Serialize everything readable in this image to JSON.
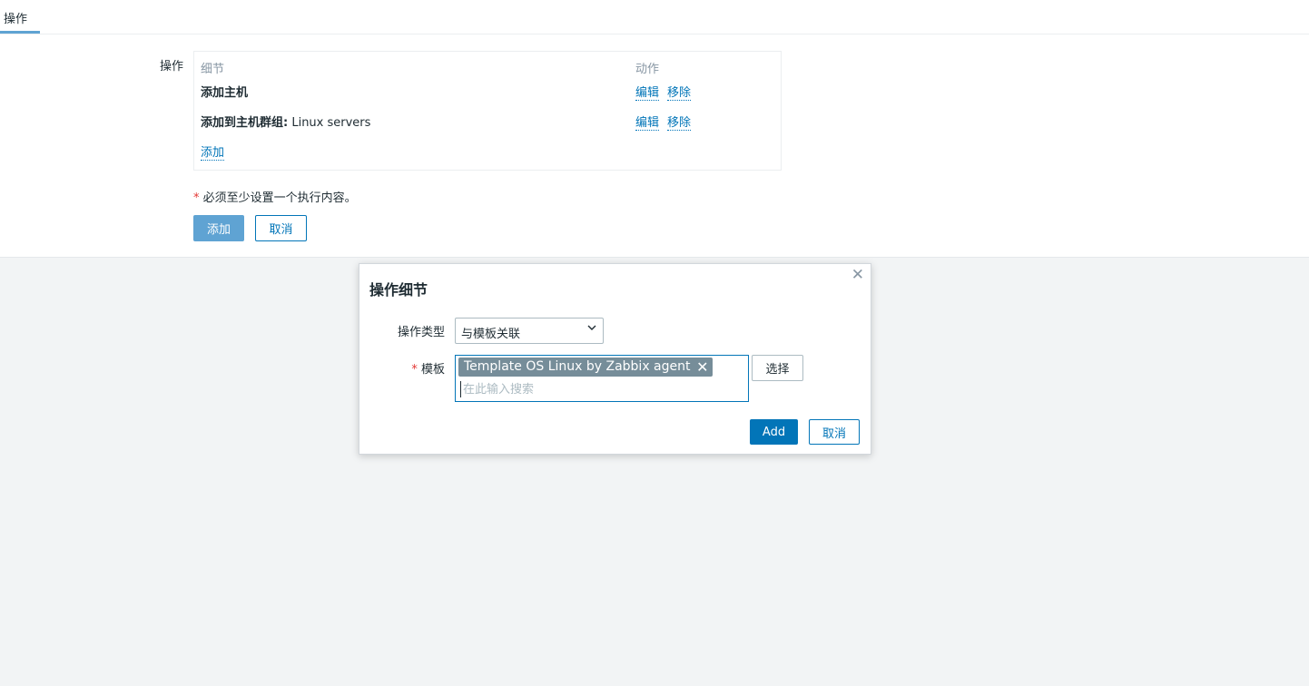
{
  "tabs": [
    {
      "label": "操作",
      "active": true
    }
  ],
  "operations": {
    "field_label": "操作",
    "headers": {
      "details": "细节",
      "actions": "动作"
    },
    "rows": [
      {
        "detail_bold": "添加主机",
        "detail_rest": "",
        "edit": "编辑",
        "remove": "移除"
      },
      {
        "detail_bold": "添加到主机群组:",
        "detail_rest": " Linux servers",
        "edit": "编辑",
        "remove": "移除"
      }
    ],
    "add_link": "添加"
  },
  "requirement_note": {
    "asterisk": "*",
    "text": "必须至少设置一个执行内容。"
  },
  "form_buttons": {
    "add": "添加",
    "cancel": "取消"
  },
  "dialog": {
    "title": "操作细节",
    "close_icon": "close-icon",
    "operation_type_label": "操作类型",
    "operation_type_value": "与模板关联",
    "template_label_required": "*",
    "template_label": "模板",
    "selected_templates": [
      "Template OS Linux by Zabbix agent"
    ],
    "search_placeholder": "在此输入搜索",
    "select_button": "选择",
    "add_button": "Add",
    "cancel_button": "取消"
  },
  "colors": {
    "accent": "#0275b8",
    "accent_faded": "#5fa3d3",
    "required": "#e33734",
    "chip_bg": "#768d99",
    "page_bg": "#f2f4f5"
  }
}
